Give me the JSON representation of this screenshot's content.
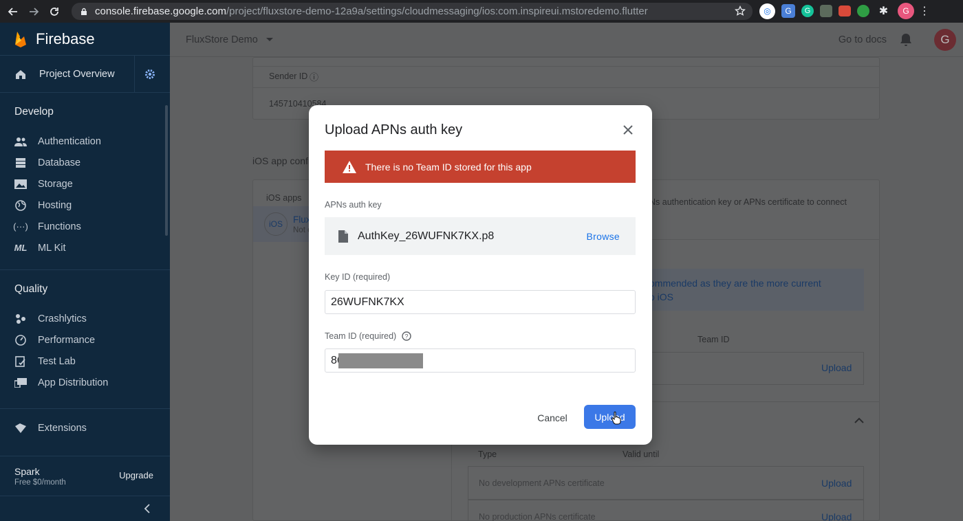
{
  "browser": {
    "url_host": "console.firebase.google.com",
    "url_path": "/project/fluxstore-demo-12a9a/settings/cloudmessaging/ios:com.inspireui.mstoredemo.flutter",
    "profile_initial": "G"
  },
  "sidebar": {
    "brand": "Firebase",
    "overview_label": "Project Overview",
    "develop_title": "Develop",
    "develop_items": [
      "Authentication",
      "Database",
      "Storage",
      "Hosting",
      "Functions",
      "ML Kit"
    ],
    "quality_title": "Quality",
    "quality_items": [
      "Crashlytics",
      "Performance",
      "Test Lab",
      "App Distribution"
    ],
    "extensions_label": "Extensions",
    "plan_name": "Spark",
    "plan_price": "Free $0/month",
    "upgrade_label": "Upgrade"
  },
  "topbar": {
    "project_name": "FluxStore Demo",
    "docs_link": "Go to docs",
    "account_initial": "G"
  },
  "background": {
    "sender_id_label": "Sender ID",
    "sender_id_value": "145710410584",
    "ios_config_heading": "iOS app confi",
    "ios_apps_label": "iOS apps",
    "ios_badge": "iOS",
    "app_name_partial": "Flux",
    "app_status_partial": "Not c",
    "apns_intro_partial": "Ns authentication key or APNs certificate to connect",
    "recommend_line1": "ommended as they are the more current",
    "recommend_line2": "o iOS",
    "team_id_header": "Team ID",
    "upload_link": "Upload",
    "cert_type_header": "Type",
    "cert_valid_header": "Valid until",
    "dev_cert_text": "No development APNs certificate",
    "prod_cert_text": "No production APNs certificate"
  },
  "modal": {
    "title": "Upload APNs auth key",
    "alert_text": "There is no Team ID stored for this app",
    "auth_key_label": "APNs auth key",
    "file_name": "AuthKey_26WUFNK7KX.p8",
    "browse_label": "Browse",
    "key_id_label": "Key ID (required)",
    "key_id_value": "26WUFNK7KX",
    "team_id_label": "Team ID (required)",
    "team_id_value": "86",
    "cancel_label": "Cancel",
    "upload_label": "Upload"
  },
  "colors": {
    "sidebar_bg": "#10283d",
    "alert_red": "#c5412f",
    "primary_blue": "#3b78e7",
    "link_blue": "#1a73e8"
  }
}
